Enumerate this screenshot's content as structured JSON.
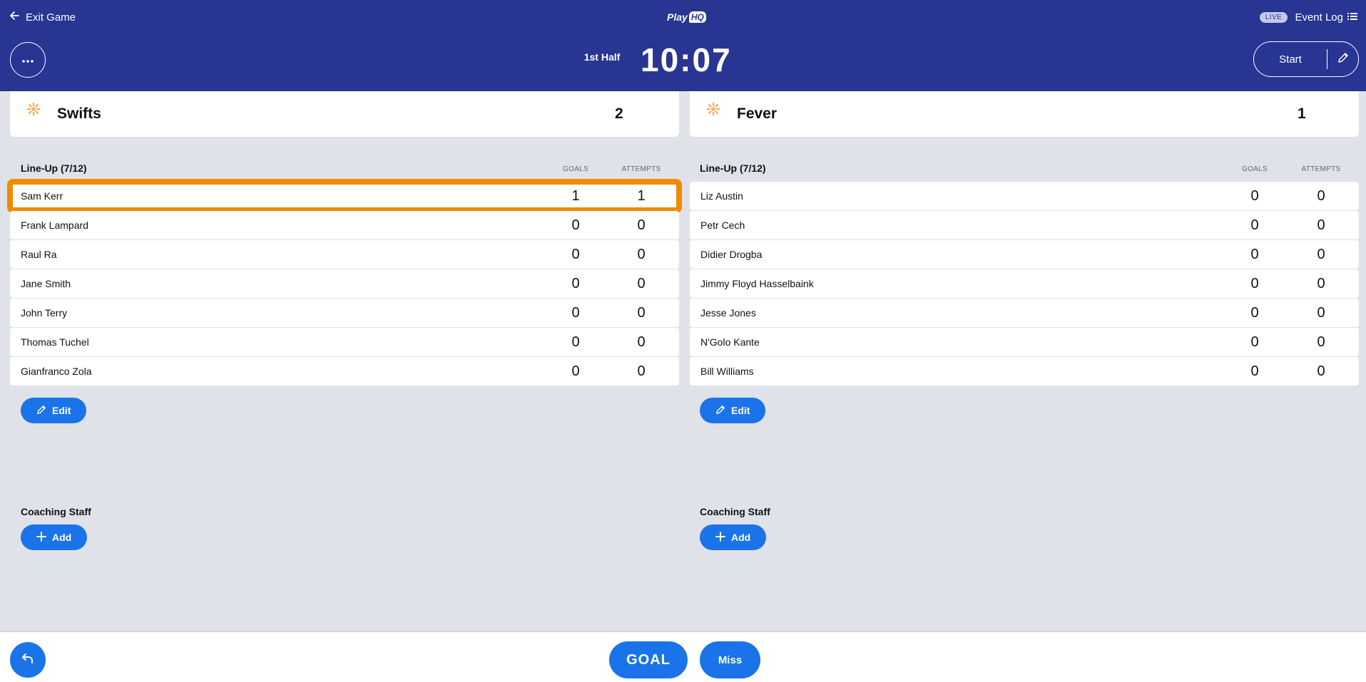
{
  "header": {
    "exit_label": "Exit Game",
    "logo_text": "Play",
    "logo_badge": "HQ",
    "live_badge": "LIVE",
    "event_log_label": "Event Log",
    "period": "1st Half",
    "clock": "10:07",
    "start_label": "Start"
  },
  "teams": [
    {
      "name": "Swifts",
      "score": "2",
      "lineup_label": "Line-Up (7/12)",
      "goals_header": "GOALS",
      "attempts_header": "ATTEMPTS",
      "players": [
        {
          "name": "Sam Kerr",
          "goals": "1",
          "attempts": "1"
        },
        {
          "name": "Frank Lampard",
          "goals": "0",
          "attempts": "0"
        },
        {
          "name": "Raul Ra",
          "goals": "0",
          "attempts": "0"
        },
        {
          "name": "Jane Smith",
          "goals": "0",
          "attempts": "0"
        },
        {
          "name": "John Terry",
          "goals": "0",
          "attempts": "0"
        },
        {
          "name": "Thomas Tuchel",
          "goals": "0",
          "attempts": "0"
        },
        {
          "name": "Gianfranco Zola",
          "goals": "0",
          "attempts": "0"
        }
      ],
      "edit_label": "Edit",
      "coaching_label": "Coaching Staff",
      "add_label": "Add"
    },
    {
      "name": "Fever",
      "score": "1",
      "lineup_label": "Line-Up (7/12)",
      "goals_header": "GOALS",
      "attempts_header": "ATTEMPTS",
      "players": [
        {
          "name": "Liz Austin",
          "goals": "0",
          "attempts": "0"
        },
        {
          "name": "Petr Cech",
          "goals": "0",
          "attempts": "0"
        },
        {
          "name": "Didier Drogba",
          "goals": "0",
          "attempts": "0"
        },
        {
          "name": "Jimmy Floyd Hasselbaink",
          "goals": "0",
          "attempts": "0"
        },
        {
          "name": "Jesse Jones",
          "goals": "0",
          "attempts": "0"
        },
        {
          "name": "N'Golo Kante",
          "goals": "0",
          "attempts": "0"
        },
        {
          "name": "Bill Williams",
          "goals": "0",
          "attempts": "0"
        }
      ],
      "edit_label": "Edit",
      "coaching_label": "Coaching Staff",
      "add_label": "Add"
    }
  ],
  "footer": {
    "goal_label": "GOAL",
    "miss_label": "Miss"
  },
  "colors": {
    "header_bg": "#283593",
    "primary_button": "#1a73e8",
    "selected_outline": "#f08a00",
    "page_bg": "#dfe2e8"
  },
  "icons": {
    "exit": "arrow-left-icon",
    "event_log": "list-icon",
    "more": "more-horizontal-icon",
    "start_edit": "pencil-icon",
    "team_logo": "sunburst-icon",
    "edit": "pencil-icon",
    "add": "plus-icon",
    "undo": "undo-arrow-icon"
  }
}
